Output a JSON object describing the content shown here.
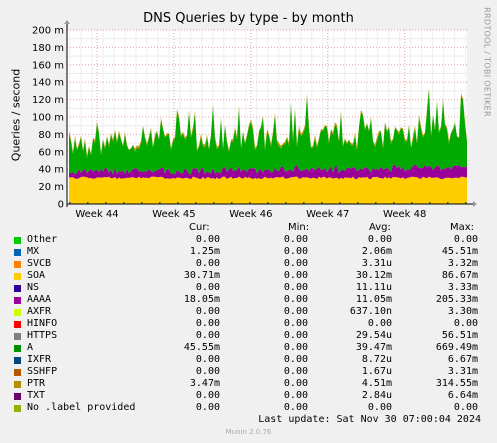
{
  "title": "DNS Queries by type - by month",
  "side_label": "RRDTOOL / TOBI OETIKER",
  "chart_data": {
    "type": "area",
    "title": "DNS Queries by type - by month",
    "ylabel": "Queries / second",
    "xlabel": "",
    "ylim": [
      0,
      200
    ],
    "y_unit": "m",
    "y_ticks": [
      "0",
      "20 m",
      "40 m",
      "60 m",
      "80 m",
      "100 m",
      "120 m",
      "140 m",
      "160 m",
      "180 m",
      "200 m"
    ],
    "x_ticks": [
      "Week 44",
      "Week 45",
      "Week 46",
      "Week 47",
      "Week 48"
    ],
    "grid": true,
    "stacked": true,
    "series": [
      {
        "name": "SOA",
        "color": "#ffcc00",
        "avg": 30.1,
        "min": 27,
        "max": 35
      },
      {
        "name": "AAAA",
        "color": "#990099",
        "avg": 9,
        "min": 3,
        "max": 16
      },
      {
        "name": "A",
        "color": "#00aa00",
        "avg": 36,
        "min": 15,
        "max": 95
      },
      {
        "name": "PTR",
        "color": "#c09000",
        "avg": 2,
        "min": 0,
        "max": 6
      }
    ]
  },
  "legend": {
    "headers": {
      "cur": "Cur:",
      "min": "Min:",
      "avg": "Avg:",
      "max": "Max:"
    },
    "rows": [
      {
        "name": "Other",
        "color": "#00cc00",
        "cur": "0.00",
        "min": "0.00",
        "avg": "0.00",
        "max": "0.00"
      },
      {
        "name": "MX",
        "color": "#0066b3",
        "cur": "1.25m",
        "min": "0.00",
        "avg": "2.06m",
        "max": "45.51m"
      },
      {
        "name": "SVCB",
        "color": "#ff8000",
        "cur": "0.00",
        "min": "0.00",
        "avg": "3.31u",
        "max": "3.32m"
      },
      {
        "name": "SOA",
        "color": "#ffcc00",
        "cur": "30.71m",
        "min": "0.00",
        "avg": "30.12m",
        "max": "86.67m"
      },
      {
        "name": "NS",
        "color": "#330099",
        "cur": "0.00",
        "min": "0.00",
        "avg": "11.11u",
        "max": "3.33m"
      },
      {
        "name": "AAAA",
        "color": "#990099",
        "cur": "18.05m",
        "min": "0.00",
        "avg": "11.05m",
        "max": "205.33m"
      },
      {
        "name": "AXFR",
        "color": "#ccff00",
        "cur": "0.00",
        "min": "0.00",
        "avg": "637.10n",
        "max": "3.30m"
      },
      {
        "name": "HINFO",
        "color": "#ff0000",
        "cur": "0.00",
        "min": "0.00",
        "avg": "0.00",
        "max": "0.00"
      },
      {
        "name": "HTTPS",
        "color": "#808080",
        "cur": "0.00",
        "min": "0.00",
        "avg": "29.54u",
        "max": "56.51m"
      },
      {
        "name": "A",
        "color": "#008f00",
        "cur": "45.55m",
        "min": "0.00",
        "avg": "39.47m",
        "max": "669.49m"
      },
      {
        "name": "IXFR",
        "color": "#00487d",
        "cur": "0.00",
        "min": "0.00",
        "avg": "8.72u",
        "max": "6.67m"
      },
      {
        "name": "SSHFP",
        "color": "#b35a00",
        "cur": "0.00",
        "min": "0.00",
        "avg": "1.67u",
        "max": "3.31m"
      },
      {
        "name": "PTR",
        "color": "#b38f00",
        "cur": "3.47m",
        "min": "0.00",
        "avg": "4.51m",
        "max": "314.55m"
      },
      {
        "name": "TXT",
        "color": "#6b006b",
        "cur": "0.00",
        "min": "0.00",
        "avg": "2.84u",
        "max": "6.64m"
      },
      {
        "name": "No .label provided",
        "color": "#8fb300",
        "cur": "0.00",
        "min": "0.00",
        "avg": "0.00",
        "max": "0.00"
      }
    ]
  },
  "last_update": "Last update:  Sat Nov 30 07:00:04 2024",
  "footer": "Munin 2.0.76"
}
